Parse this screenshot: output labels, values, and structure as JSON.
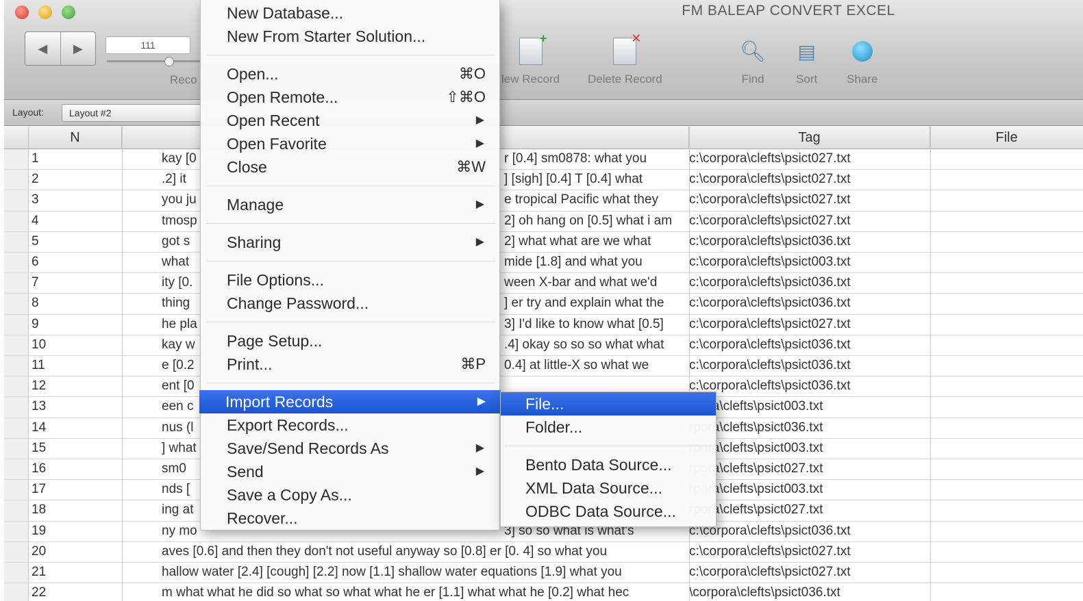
{
  "window": {
    "title": "FM BALEAP CONVERT EXCEL",
    "record_field": "111",
    "records_label": "Reco"
  },
  "toolbar": {
    "new_record": "New Record",
    "new_record_visible": "lew Record",
    "delete_record": "Delete Record",
    "find": "Find",
    "sort": "Sort",
    "share": "Share"
  },
  "layout_bar": {
    "caption": "Layout:",
    "selected_layout": "Layout #2"
  },
  "table": {
    "columns": [
      "N",
      "Tag",
      "File"
    ],
    "rows": [
      {
        "n": "1",
        "text": "kay [0",
        "text_right": "r [0.4]   sm0878: what you",
        "tag": "c:\\corpora\\clefts\\psict027.txt"
      },
      {
        "n": "2",
        "text": ".2]  it",
        "text_right": "] [sigh] [0.4] T [0.4] what",
        "tag": "c:\\corpora\\clefts\\psict027.txt"
      },
      {
        "n": "3",
        "text": "you ju",
        "text_right": "e  tropical Pacific what they",
        "tag": "c:\\corpora\\clefts\\psict027.txt"
      },
      {
        "n": "4",
        "text": "tmosp",
        "text_right": "2] oh hang on [0.5] what i am",
        "tag": "c:\\corpora\\clefts\\psict027.txt"
      },
      {
        "n": "5",
        "text": " got s",
        "text_right": "2] what what are we what",
        "tag": "c:\\corpora\\clefts\\psict036.txt"
      },
      {
        "n": "6",
        "text": "what ",
        "text_right": "mide [1.8]   and what you",
        "tag": "c:\\corpora\\clefts\\psict003.txt"
      },
      {
        "n": "7",
        "text": "ity [0.",
        "text_right": "ween X-bar and what we'd",
        "tag": "c:\\corpora\\clefts\\psict036.txt"
      },
      {
        "n": "8",
        "text": " thing",
        "text_right": "] er try and explain what the",
        "tag": "c:\\corpora\\clefts\\psict036.txt"
      },
      {
        "n": "9",
        "text": "he pla",
        "text_right": "3]   I'd like to know what [0.5]",
        "tag": "c:\\corpora\\clefts\\psict027.txt"
      },
      {
        "n": "10",
        "text": "kay w",
        "text_right": ".4] okay so so so what what",
        "tag": "c:\\corpora\\clefts\\psict036.txt"
      },
      {
        "n": "11",
        "text": "e [0.2",
        "text_right": "0.4] at little-X so what we",
        "tag": "c:\\corpora\\clefts\\psict036.txt"
      },
      {
        "n": "12",
        "text": "ent [0",
        "text_right": "",
        "tag": "c:\\corpora\\clefts\\psict036.txt"
      },
      {
        "n": "13",
        "text": "een c",
        "text_right": "",
        "tag": "rpora\\clefts\\psict003.txt"
      },
      {
        "n": "14",
        "text": "nus (l",
        "text_right": "",
        "tag": "rpora\\clefts\\psict036.txt"
      },
      {
        "n": "15",
        "text": "] what",
        "text_right": "",
        "tag": "rpora\\clefts\\psict003.txt"
      },
      {
        "n": "16",
        "text": "  sm0",
        "text_right": "",
        "tag": "rpora\\clefts\\psict027.txt"
      },
      {
        "n": "17",
        "text": "nds [",
        "text_right": "",
        "tag": "rpora\\clefts\\psict003.txt"
      },
      {
        "n": "18",
        "text": "ing at",
        "text_right": "",
        "tag": "rpora\\clefts\\psict027.txt"
      },
      {
        "n": "19",
        "text": "ny mo",
        "text_right": "3] so so what is   what's",
        "tag": "c:\\corpora\\clefts\\psict036.txt"
      },
      {
        "n": "20",
        "text": "aves [0.6] and then they don't not useful anyway so [0.8] er [0.  4] so what you",
        "text_right": "",
        "tag": "c:\\corpora\\clefts\\psict027.txt"
      },
      {
        "n": "21",
        "text": "hallow water [2.4] [cough] [2.2] now [1.1] shallow water   equations [1.9] what you",
        "text_right": "",
        "tag": "c:\\corpora\\clefts\\psict027.txt"
      },
      {
        "n": "22",
        "text": "m what what he   did so what so what what he er [1.1] what what he [0.2] what hec",
        "text_right": "",
        "tag": "\\corpora\\clefts\\psict036.txt"
      }
    ]
  },
  "file_menu": {
    "items": [
      {
        "label": "New Database...",
        "shortcut": "",
        "submenu": false
      },
      {
        "label": "New From Starter Solution...",
        "shortcut": "",
        "submenu": false
      },
      {
        "label": "Open...",
        "shortcut": "⌘O",
        "submenu": false
      },
      {
        "label": "Open Remote...",
        "shortcut": "⇧⌘O",
        "submenu": false
      },
      {
        "label": "Open Recent",
        "shortcut": "",
        "submenu": true
      },
      {
        "label": "Open Favorite",
        "shortcut": "",
        "submenu": true
      },
      {
        "label": "Close",
        "shortcut": "⌘W",
        "submenu": false
      },
      {
        "label": "Manage",
        "shortcut": "",
        "submenu": true
      },
      {
        "label": "Sharing",
        "shortcut": "",
        "submenu": true
      },
      {
        "label": "File Options...",
        "shortcut": "",
        "submenu": false
      },
      {
        "label": "Change Password...",
        "shortcut": "",
        "submenu": false
      },
      {
        "label": "Page Setup...",
        "shortcut": "",
        "submenu": false
      },
      {
        "label": "Print...",
        "shortcut": "⌘P",
        "submenu": false
      },
      {
        "label": "Import Records",
        "shortcut": "",
        "submenu": true,
        "highlighted": true
      },
      {
        "label": "Export Records...",
        "shortcut": "",
        "submenu": false
      },
      {
        "label": "Save/Send Records As",
        "shortcut": "",
        "submenu": true
      },
      {
        "label": "Send",
        "shortcut": "",
        "submenu": true
      },
      {
        "label": "Save a Copy As...",
        "shortcut": "",
        "submenu": false
      },
      {
        "label": "Recover...",
        "shortcut": "",
        "submenu": false
      }
    ]
  },
  "import_submenu": {
    "items": [
      {
        "label": "File...",
        "highlighted": true
      },
      {
        "label": "Folder..."
      },
      {
        "label": "Bento Data Source..."
      },
      {
        "label": "XML Data Source..."
      },
      {
        "label": "ODBC Data Source..."
      }
    ]
  },
  "colors": {
    "highlight": "#1a55d4",
    "toolbar_bg": "#c9c9c9"
  },
  "icons": [
    "close-window",
    "minimize-window",
    "zoom-window",
    "prev-arrow",
    "next-arrow",
    "new-record-icon",
    "delete-record-icon",
    "find-icon",
    "sort-icon",
    "share-icon",
    "submenu-arrow"
  ]
}
